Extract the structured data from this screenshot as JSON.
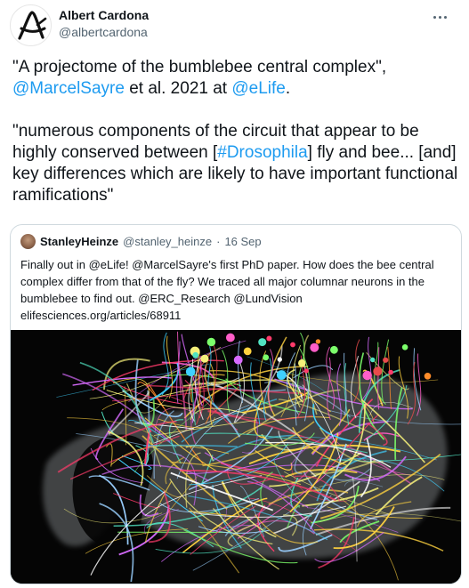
{
  "tweet": {
    "author": {
      "name": "Albert Cardona",
      "handle": "@albertcardona"
    },
    "text": {
      "p1_a": "\"A projectome of the bumblebee central complex\",",
      "p1_mention1": "@MarcelSayre",
      "p1_b": " et al. 2021 at ",
      "p1_mention2": "@eLife",
      "p1_c": ".",
      "p2_a": "\"numerous components of the circuit that appear to be highly conserved between [",
      "p2_hashtag": "#Drosophila",
      "p2_b": "] fly and bee... [and] key differences which are likely to have important functional ramifications\""
    }
  },
  "quoted": {
    "author": {
      "name": "StanleyHeinze",
      "handle": "@stanley_heinze",
      "separator": "·",
      "date": "16 Sep"
    },
    "text": {
      "l1": "Finally out in @eLife! @MarcelSayre's first PhD paper. How does the bee central",
      "l2": "complex differ from that of the fly? We traced all major columnar neurons in the",
      "l3": "bumblebee to find out. @ERC_Research @LundVision",
      "l4": "elifesciences.org/articles/68911"
    }
  },
  "icons": {
    "more": "more-horizontal-icon",
    "avatar": "logo-avatar-icon"
  },
  "colors": {
    "link": "#1d9bf0",
    "text": "#0f1419",
    "muted": "#536471",
    "border": "#cfd9de"
  }
}
